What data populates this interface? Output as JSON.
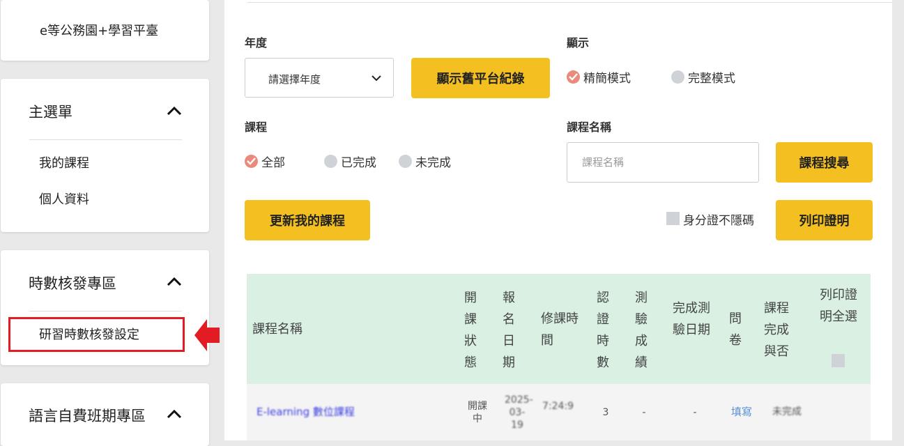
{
  "sidebar": {
    "site_title": "e等公務園+學習平臺",
    "main_menu": {
      "title": "主選單",
      "items": [
        "我的課程",
        "個人資料"
      ]
    },
    "hours_menu": {
      "title": "時數核發專區",
      "items": [
        "研習時數核發設定"
      ]
    },
    "language_menu": {
      "title": "語言自費班期專區"
    }
  },
  "filters": {
    "year_label": "年度",
    "year_select": "請選擇年度",
    "show_old_button": "顯示舊平台紀錄",
    "display_label": "顯示",
    "display_options": [
      "精簡模式",
      "完整模式"
    ],
    "display_selected": "精簡模式",
    "course_label": "課程",
    "course_options": [
      "全部",
      "已完成",
      "未完成"
    ],
    "course_selected": "全部",
    "course_name_label": "課程名稱",
    "course_name_placeholder": "課程名稱",
    "search_button": "課程搜尋",
    "update_button": "更新我的課程",
    "hide_id_label": "身分證不隱碼",
    "print_button": "列印證明"
  },
  "table": {
    "headers": {
      "course_name": "課程名稱",
      "status": "開課狀態",
      "enroll_date": "報名日期",
      "study_time": "修課時間",
      "cert_hours": "認證時數",
      "quiz_score": "測驗成績",
      "quiz_complete_date": "完成測驗日期",
      "survey": "問卷",
      "course_complete": "課程完成與否",
      "print_all": "列印證明全選"
    },
    "rows": [
      {
        "course_name": "E-learning 數位課程",
        "status": "開課中",
        "enroll_date": "2025-03-19",
        "study_time": "7:24:9",
        "cert_hours": "3",
        "quiz_score": "-",
        "quiz_complete_date": "-",
        "survey": "填寫",
        "course_complete": "未完成"
      }
    ]
  },
  "colors": {
    "accent": "#f4c021",
    "header_bg": "#d9f0e3",
    "annotation": "#e31c23",
    "link": "#5b8fd6"
  }
}
